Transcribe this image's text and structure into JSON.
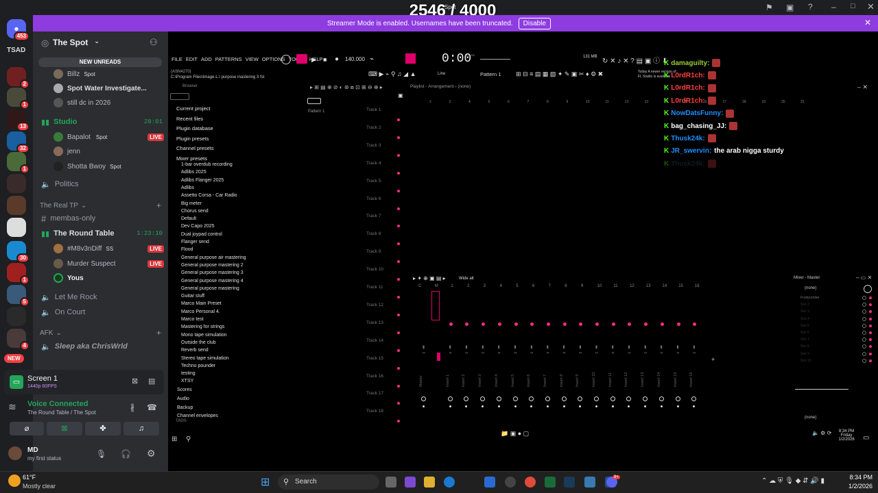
{
  "counter": "2546 / 4000",
  "overlay_title": "Spot",
  "banner": {
    "text": "Streamer Mode is enabled. Usernames have been truncated.",
    "button": "Disable"
  },
  "rail": {
    "top_badge": "453",
    "tsad": "TSAD",
    "new": "NEW",
    "badges": [
      "2",
      "1",
      "13",
      "32",
      "1",
      "30",
      "1",
      "5",
      "4"
    ]
  },
  "server": {
    "name": "The Spot",
    "new_unreads": "NEW UNREADS"
  },
  "channels": {
    "top_users": [
      {
        "name": "Billz",
        "activity": "Spot"
      },
      {
        "name": "Spot Water Investigate..."
      },
      {
        "name": "still dc in 2026"
      }
    ],
    "studio": {
      "name": "Studio",
      "time": "28:01",
      "users": [
        {
          "name": "Bapalot",
          "activity": "Spot",
          "live": "LIVE"
        },
        {
          "name": "jenn"
        },
        {
          "name": "Shotta Bwoy",
          "activity": "Spot"
        }
      ]
    },
    "politics": "Politics",
    "cat_realtp": "The Real TP",
    "membas": "membas-only",
    "roundtable": {
      "name": "The Round Table",
      "time": "1:23:10",
      "users": [
        {
          "name": "#M8v3nDiff",
          "extra": "SS",
          "live": "LIVE"
        },
        {
          "name": "Murder Suspect",
          "live": "LIVE"
        },
        {
          "name": "Yous"
        }
      ]
    },
    "letmerock": "Let Me Rock",
    "oncourt": "On Court",
    "cat_afk": "AFK",
    "afk_user": "Sleep aka ChrisWrld"
  },
  "screen": {
    "title": "Screen 1",
    "quality": "1440p 60FPS"
  },
  "voice": {
    "status": "Voice Connected",
    "location": "The Round Table / The Spot"
  },
  "user": {
    "name": "MD",
    "status": "my first status"
  },
  "fl": {
    "menu": [
      "FILE",
      "EDIT",
      "ADD",
      "PATTERNS",
      "VIEW",
      "OPTIONS",
      "TOOLS",
      "HELP"
    ],
    "bpm": "140.000",
    "time": "0:00",
    "time_suffix": "M:S:CS",
    "mem": "131 MB",
    "pattern": "Pattern 1",
    "line": "Line",
    "path": "C:\\Program Files\\Image-L.\\ purpose mastering 3 fst",
    "asn": "(ASN4270)",
    "browser_label": "Browser",
    "playlist_title": "Playlist - Arrangement",
    "playlist_none": "(none)",
    "pattern_item": "Pattern 1",
    "hint1": "Today  A newer version of",
    "hint2": "FL Studio is available",
    "browser_folders": [
      "Current project",
      "Recent files",
      "Plugin database",
      "Plugin presets",
      "Channel presets",
      "Mixer presets"
    ],
    "browser_items": [
      "1-bar overdub recording",
      "Adlibs 2025",
      "Adlibs Flanger 2025",
      "Adlibs",
      "Assetto Corsa - Car Radio",
      "Big meter",
      "Chorus send",
      "Default",
      "Dev Capo 2025",
      "Dual joypad control",
      "Flanger send",
      "Flood",
      "General purpose air mastering",
      "General purpose mastering 2",
      "General purpose mastering 3",
      "General purpose mastering 4",
      "General purpose mastering",
      "Guitar stuff",
      "Marco Main Preset",
      "Marco Personal 4.",
      "Marco test",
      "Mastering for strings",
      "Mono tape simulation",
      "Outside the club",
      "Reverb send",
      "Stereo tape simulation",
      "Techno pounder",
      "testing",
      "XTSY"
    ],
    "browser_bottom": [
      "Scores",
      "Audio",
      "Backup",
      "Channel envelopes"
    ],
    "tags": "TAGS",
    "tracks": [
      "Track 1",
      "Track 2",
      "Track 3",
      "Track 4",
      "Track 5",
      "Track 6",
      "Track 7",
      "Track 8",
      "Track 9",
      "Track 10",
      "Track 11",
      "Track 12",
      "Track 13",
      "Track 14",
      "Track 15",
      "Track 16",
      "Track 17",
      "Track 18"
    ],
    "ruler": [
      "2",
      "3",
      "4",
      "5",
      "6",
      "7",
      "8",
      "9",
      "10",
      "11",
      "12",
      "13",
      "14",
      "15",
      "16",
      "17",
      "18",
      "19",
      "20",
      "21"
    ],
    "mixer_preset": "Wide alt",
    "mixer_nums": [
      "C",
      "M",
      "1",
      "2",
      "3",
      "4",
      "5",
      "6",
      "7",
      "8",
      "9",
      "10",
      "11",
      "12",
      "13",
      "14",
      "15",
      "16"
    ],
    "mixer_names": [
      "Master",
      "Insert 1",
      "Insert 2",
      "Insert 3",
      "Insert 4",
      "Insert 5",
      "Insert 6",
      "Insert 7",
      "Insert 8",
      "Insert 9",
      "Insert 10",
      "Insert 11",
      "Insert 12",
      "Insert 13",
      "Insert 14",
      "Insert 15",
      "Insert 16"
    ],
    "mixer_master_title": "Mixer - Master",
    "mixer_none": "(none)",
    "mixer_slots": [
      "FruityLimiter",
      "Slot 2",
      "Slot 3",
      "Slot 4",
      "Slot 5",
      "Slot 6",
      "Slot 7",
      "Slot 8",
      "Slot 9",
      "Slot 10"
    ],
    "mixer_none2": "(none)"
  },
  "chat": [
    {
      "name": "damaguilty",
      "color": "#9acd32"
    },
    {
      "name": "L0rdR1ch",
      "color": "#ff4040"
    },
    {
      "name": "L0rdR1ch",
      "color": "#ff4040"
    },
    {
      "name": "L0rdR1ch",
      "color": "#ff4040"
    },
    {
      "name": "NowDatsFunny",
      "color": "#1e90ff"
    },
    {
      "name": "bag_chasing_JJ",
      "color": "#ffffff"
    },
    {
      "name": "Thusk24k",
      "color": "#1e90ff"
    },
    {
      "name": "JR_swervin",
      "color": "#1e90ff",
      "message": "the arab nigga sturdy"
    },
    {
      "name": "Thusk24k",
      "color": "#2a4a6a"
    }
  ],
  "desktop_clock": {
    "time": "8:34 PM",
    "day": "Friday",
    "date": "1/2/2026"
  },
  "taskbar": {
    "weather_temp": "61°F",
    "weather_desc": "Mostly clear",
    "search": "Search",
    "time": "8:34 PM",
    "date": "1/2/2026",
    "discord_badge": "9+"
  }
}
